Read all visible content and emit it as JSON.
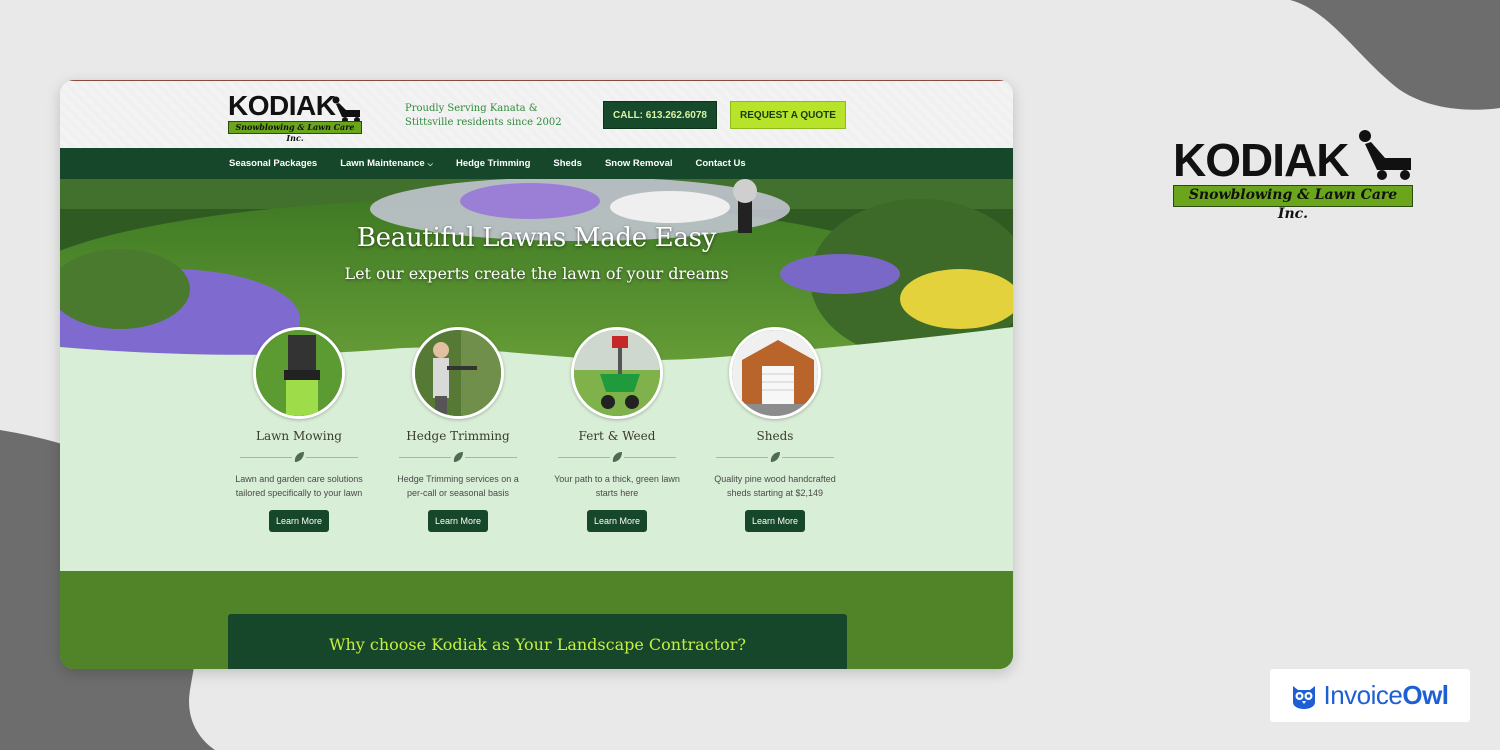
{
  "brand": {
    "name": "KODIAK",
    "strip_text": "Snowblowing & Lawn Care Inc."
  },
  "header": {
    "tagline": "Proudly Serving Kanata & Stittsville residents since 2002",
    "call_label": "CALL: 613.262.6078",
    "quote_label": "REQUEST A QUOTE"
  },
  "nav": {
    "items": [
      {
        "label": "Seasonal Packages"
      },
      {
        "label": "Lawn Maintenance",
        "caret": "⌵"
      },
      {
        "label": "Hedge Trimming"
      },
      {
        "label": "Sheds"
      },
      {
        "label": "Snow Removal"
      },
      {
        "label": "Contact Us"
      }
    ]
  },
  "hero": {
    "title": "Beautiful Lawns Made Easy",
    "subtitle": "Let our experts create the lawn of your dreams"
  },
  "services": [
    {
      "title": "Lawn Mowing",
      "desc": "Lawn and garden care solutions tailored specifically to your lawn",
      "button": "Learn More",
      "icon": "lawn-mowing-photo"
    },
    {
      "title": "Hedge Trimming",
      "desc": "Hedge Trimming services on a per-call or seasonal basis",
      "button": "Learn More",
      "icon": "hedge-trimming-photo"
    },
    {
      "title": "Fert & Weed",
      "desc": "Your path to a thick, green lawn starts here",
      "button": "Learn More",
      "icon": "fertilizer-spreader-photo"
    },
    {
      "title": "Sheds",
      "desc": "Quality pine wood handcrafted sheds starting at $2,149",
      "button": "Learn More",
      "icon": "shed-photo"
    }
  ],
  "why": {
    "title": "Why choose Kodiak as Your Landscape Contractor?"
  },
  "badge": {
    "prefix": "Invoice",
    "suffix": "Owl"
  },
  "colors": {
    "nav_green": "#16472a",
    "accent_lime": "#b7e32a",
    "panel_mint": "#d8eed6",
    "owl_blue": "#1f5fd4"
  }
}
